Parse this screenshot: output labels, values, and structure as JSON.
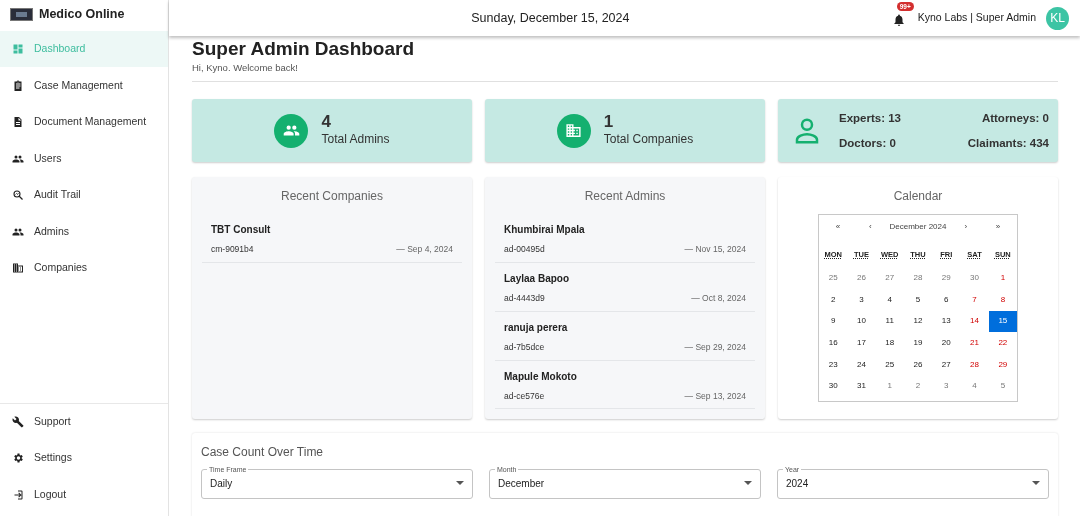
{
  "brand": {
    "name": "Medico Online"
  },
  "sidebar": {
    "items": [
      {
        "label": "Dashboard",
        "selected": true
      },
      {
        "label": "Case Management",
        "selected": false
      },
      {
        "label": "Document Management",
        "selected": false
      },
      {
        "label": "Users",
        "selected": false
      },
      {
        "label": "Audit Trail",
        "selected": false
      },
      {
        "label": "Admins",
        "selected": false
      },
      {
        "label": "Companies",
        "selected": false
      }
    ],
    "bottom_items": [
      {
        "label": "Support"
      },
      {
        "label": "Settings"
      },
      {
        "label": "Logout"
      }
    ]
  },
  "header": {
    "date": "Sunday, December 15, 2024",
    "notification_count": "99+",
    "user": "Kyno Labs | Super Admin",
    "avatar": "KL"
  },
  "page": {
    "title": "Super Admin Dashboard",
    "subtitle": "Hi, Kyno. Welcome back!"
  },
  "stat_cards": [
    {
      "kind": "count",
      "value": "4",
      "label": "Total Admins"
    },
    {
      "kind": "count",
      "value": "1",
      "label": "Total Companies"
    },
    {
      "kind": "breakdown",
      "entries": [
        "Experts: 13",
        "Attorneys: 0",
        "Doctors: 0",
        "Claimants: 434"
      ]
    }
  ],
  "recent_companies": {
    "title": "Recent Companies",
    "items": [
      {
        "name": "TBT Consult",
        "id": "cm-9091b4",
        "date": "— Sep 4, 2024"
      }
    ]
  },
  "recent_admins": {
    "title": "Recent Admins",
    "items": [
      {
        "name": "Khumbirai Mpala",
        "id": "ad-00495d",
        "date": "— Nov 15, 2024"
      },
      {
        "name": "Laylaa Bapoo",
        "id": "ad-4443d9",
        "date": "— Oct 8, 2024"
      },
      {
        "name": "ranuja perera",
        "id": "ad-7b5dce",
        "date": "— Sep 29, 2024"
      },
      {
        "name": "Mapule Mokoto",
        "id": "ad-ce576e",
        "date": "— Sep 13, 2024"
      }
    ]
  },
  "calendar": {
    "title": "Calendar",
    "nav": [
      "«",
      "‹",
      "›",
      "»"
    ],
    "month": "December 2024",
    "weekdays": [
      "MON",
      "TUE",
      "WED",
      "THU",
      "FRI",
      "SAT",
      "SUN"
    ],
    "days": [
      {
        "label": "25",
        "kind": "outside",
        "selected": false
      },
      {
        "label": "26",
        "kind": "outside",
        "selected": false
      },
      {
        "label": "27",
        "kind": "outside",
        "selected": false
      },
      {
        "label": "28",
        "kind": "outside",
        "selected": false
      },
      {
        "label": "29",
        "kind": "outside",
        "selected": false
      },
      {
        "label": "30",
        "kind": "outside",
        "selected": false
      },
      {
        "label": "1",
        "kind": "weekend",
        "selected": false
      },
      {
        "label": "2",
        "kind": "day",
        "selected": false
      },
      {
        "label": "3",
        "kind": "day",
        "selected": false
      },
      {
        "label": "4",
        "kind": "day",
        "selected": false
      },
      {
        "label": "5",
        "kind": "day",
        "selected": false
      },
      {
        "label": "6",
        "kind": "day",
        "selected": false
      },
      {
        "label": "7",
        "kind": "weekend",
        "selected": false
      },
      {
        "label": "8",
        "kind": "weekend",
        "selected": false
      },
      {
        "label": "9",
        "kind": "day",
        "selected": false
      },
      {
        "label": "10",
        "kind": "day",
        "selected": false
      },
      {
        "label": "11",
        "kind": "day",
        "selected": false
      },
      {
        "label": "12",
        "kind": "day",
        "selected": false
      },
      {
        "label": "13",
        "kind": "day",
        "selected": false
      },
      {
        "label": "14",
        "kind": "weekend",
        "selected": false
      },
      {
        "label": "15",
        "kind": "weekend",
        "selected": true
      },
      {
        "label": "16",
        "kind": "day",
        "selected": false
      },
      {
        "label": "17",
        "kind": "day",
        "selected": false
      },
      {
        "label": "18",
        "kind": "day",
        "selected": false
      },
      {
        "label": "19",
        "kind": "day",
        "selected": false
      },
      {
        "label": "20",
        "kind": "day",
        "selected": false
      },
      {
        "label": "21",
        "kind": "weekend",
        "selected": false
      },
      {
        "label": "22",
        "kind": "weekend",
        "selected": false
      },
      {
        "label": "23",
        "kind": "day",
        "selected": false
      },
      {
        "label": "24",
        "kind": "day",
        "selected": false
      },
      {
        "label": "25",
        "kind": "day",
        "selected": false
      },
      {
        "label": "26",
        "kind": "day",
        "selected": false
      },
      {
        "label": "27",
        "kind": "day",
        "selected": false
      },
      {
        "label": "28",
        "kind": "weekend",
        "selected": false
      },
      {
        "label": "29",
        "kind": "weekend",
        "selected": false
      },
      {
        "label": "30",
        "kind": "day",
        "selected": false
      },
      {
        "label": "31",
        "kind": "day",
        "selected": false
      },
      {
        "label": "1",
        "kind": "outside",
        "selected": false
      },
      {
        "label": "2",
        "kind": "outside",
        "selected": false
      },
      {
        "label": "3",
        "kind": "outside",
        "selected": false
      },
      {
        "label": "4",
        "kind": "outside",
        "selected": false
      },
      {
        "label": "5",
        "kind": "outside",
        "selected": false
      }
    ]
  },
  "case_count": {
    "title": "Case Count Over Time",
    "filters": [
      {
        "label": "Time Frame",
        "value": "Daily"
      },
      {
        "label": "Month",
        "value": "December"
      },
      {
        "label": "Year",
        "value": "2024"
      }
    ]
  }
}
